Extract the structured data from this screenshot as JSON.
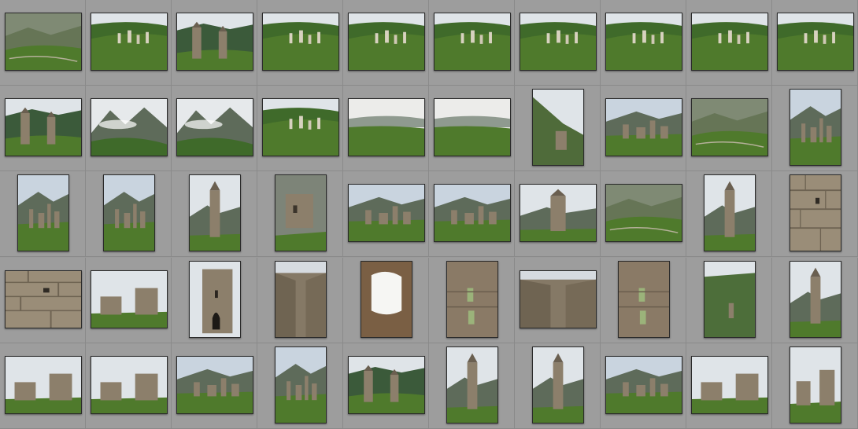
{
  "grid": {
    "rows": [
      [
        "valley-landscape",
        "valley-towers-distant",
        "twin-towers-green",
        "valley-towers-distant",
        "valley-towers-distant",
        "valley-towers-distant",
        "valley-towers-distant",
        "valley-towers-distant",
        "valley-towers-distant",
        "valley-towers-distant"
      ],
      [
        "twin-towers-green",
        "misty-mountain",
        "misty-mountain",
        "valley-towers-distant",
        "misty-valley",
        "misty-valley",
        "hillside-ruin",
        "tower-cluster",
        "valley-landscape",
        "tower-cluster"
      ],
      [
        "tower-cluster",
        "tower-cluster",
        "single-tower",
        "stone-ruin-closeup",
        "tower-cluster",
        "tower-cluster",
        "single-tower",
        "valley-landscape",
        "single-tower",
        "stone-wall"
      ],
      [
        "stone-wall",
        "ruins-pair",
        "tower-doorway",
        "stone-interior",
        "window-opening",
        "stone-wall-windows",
        "stone-interior",
        "stone-wall-windows",
        "green-field-ruin",
        "single-tower"
      ],
      [
        "ruins-pair",
        "ruins-pair",
        "tower-cluster",
        "tower-cluster",
        "twin-towers-green",
        "single-tower",
        "single-tower",
        "tower-cluster",
        "ruins-pair",
        "ruins-pair"
      ]
    ],
    "orientations": [
      [
        "landscape",
        "landscape",
        "landscape",
        "landscape",
        "landscape",
        "landscape",
        "landscape",
        "landscape",
        "landscape",
        "landscape"
      ],
      [
        "landscape",
        "landscape",
        "landscape",
        "landscape",
        "landscape",
        "landscape",
        "portrait",
        "landscape",
        "landscape",
        "portrait"
      ],
      [
        "portrait",
        "portrait",
        "portrait",
        "portrait",
        "landscape",
        "landscape",
        "landscape",
        "landscape",
        "portrait",
        "portrait"
      ],
      [
        "landscape",
        "landscape",
        "portrait",
        "portrait",
        "portrait",
        "portrait",
        "landscape",
        "portrait",
        "portrait",
        "portrait"
      ],
      [
        "landscape",
        "landscape",
        "landscape",
        "portrait",
        "landscape",
        "portrait",
        "portrait",
        "landscape",
        "landscape",
        "portrait"
      ]
    ]
  },
  "colors": {
    "background": "#9a9a9a",
    "sky": "#dfe4e8",
    "grass": "#4f7a2c",
    "mountain": "#5e6b5a",
    "stone": "#8c7f6b"
  }
}
